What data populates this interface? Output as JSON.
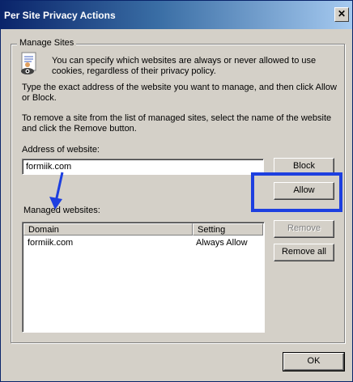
{
  "window": {
    "title": "Per Site Privacy Actions",
    "close_glyph": "✕"
  },
  "group": {
    "label": "Manage Sites"
  },
  "info": {
    "line1": "You can specify which websites are always or never allowed to use",
    "line2": "cookies, regardless of their privacy policy.",
    "icon": "privacy-eye-icon"
  },
  "instructions": {
    "type_line1": "Type the exact address of the website you want to manage, and then click Allow",
    "type_line2": "or Block.",
    "remove_line1": "To remove a site from the list of managed sites, select the name of the website",
    "remove_line2": "and click the Remove button."
  },
  "address": {
    "label": "Address of website:",
    "value": "formiik.com"
  },
  "buttons": {
    "block": "Block",
    "allow": "Allow",
    "remove": "Remove",
    "remove_all": "Remove all",
    "ok": "OK"
  },
  "managed": {
    "label": "Managed websites:",
    "columns": [
      "Domain",
      "Setting"
    ],
    "rows": [
      {
        "domain": "formiik.com",
        "setting": "Always Allow"
      }
    ]
  },
  "annotation": {
    "highlight_color": "#1d3fe0"
  }
}
